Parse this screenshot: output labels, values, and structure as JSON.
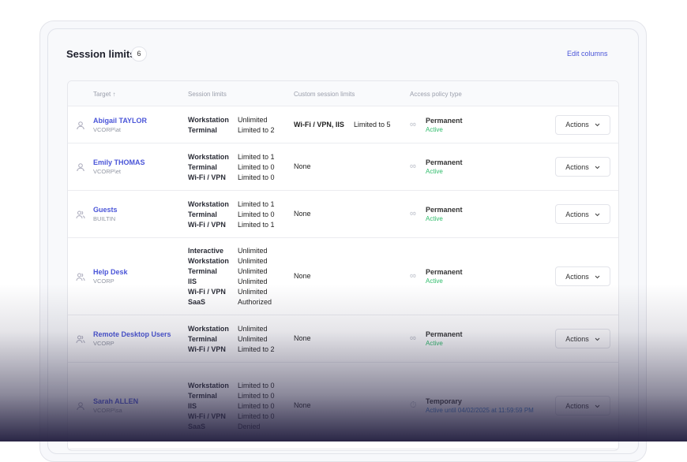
{
  "header": {
    "title": "Session limits",
    "count": "6",
    "edit_columns": "Edit columns"
  },
  "columns": {
    "target": "Target",
    "sort_icon": "↑",
    "session_limits": "Session limits",
    "custom_limits": "Custom session limits",
    "policy_type": "Access policy type"
  },
  "rows": [
    {
      "name": "Abigail TAYLOR",
      "sub": "VCORP\\at",
      "icon": "user",
      "limits": [
        [
          "Workstation",
          "Unlimited"
        ],
        [
          "Terminal",
          "Limited to 2"
        ]
      ],
      "custom": "Wi-Fi / VPN, IIS",
      "custom_limit": "Limited to 5",
      "policy": "Permanent",
      "status": "Active",
      "temp": false,
      "action": "Actions"
    },
    {
      "name": "Emily THOMAS",
      "sub": "VCORP\\et",
      "icon": "user",
      "limits": [
        [
          "Workstation",
          "Limited to 1"
        ],
        [
          "Terminal",
          "Limited to 0"
        ],
        [
          "Wi-Fi / VPN",
          "Limited to 0"
        ]
      ],
      "custom": "None",
      "policy": "Permanent",
      "status": "Active",
      "temp": false,
      "action": "Actions"
    },
    {
      "name": "Guests",
      "sub": "BUILTIN",
      "icon": "group",
      "limits": [
        [
          "Workstation",
          "Limited to 1"
        ],
        [
          "Terminal",
          "Limited to 0"
        ],
        [
          "Wi-Fi / VPN",
          "Limited to 1"
        ]
      ],
      "custom": "None",
      "policy": "Permanent",
      "status": "Active",
      "temp": false,
      "action": "Actions"
    },
    {
      "name": "Help Desk",
      "sub": "VCORP",
      "icon": "group",
      "limits": [
        [
          "Interactive",
          "Unlimited"
        ],
        [
          "Workstation",
          "Unlimited"
        ],
        [
          "Terminal",
          "Unlimited"
        ],
        [
          "IIS",
          "Unlimited"
        ],
        [
          "Wi-Fi / VPN",
          "Unlimited"
        ],
        [
          "SaaS",
          "Authorized"
        ]
      ],
      "custom": "None",
      "policy": "Permanent",
      "status": "Active",
      "temp": false,
      "action": "Actions"
    },
    {
      "name": "Remote Desktop Users",
      "sub": "VCORP",
      "icon": "group",
      "limits": [
        [
          "Workstation",
          "Unlimited"
        ],
        [
          "Terminal",
          "Unlimited"
        ],
        [
          "Wi-Fi / VPN",
          "Limited to 2"
        ]
      ],
      "custom": "None",
      "policy": "Permanent",
      "status": "Active",
      "temp": false,
      "action": "Actions"
    },
    {
      "name": "Sarah ALLEN",
      "sub": "VCORP\\sa",
      "icon": "user",
      "limits": [
        [
          "Workstation",
          "Limited to 0"
        ],
        [
          "Terminal",
          "Limited to 0"
        ],
        [
          "IIS",
          "Limited to 0"
        ],
        [
          "Wi-Fi / VPN",
          "Limited to 0"
        ],
        [
          "SaaS",
          "Denied"
        ]
      ],
      "custom": "None",
      "policy": "Temporary",
      "status": "Active until 04/02/2025 at 11:59:59 PM",
      "temp": true,
      "action": "Actions"
    }
  ]
}
